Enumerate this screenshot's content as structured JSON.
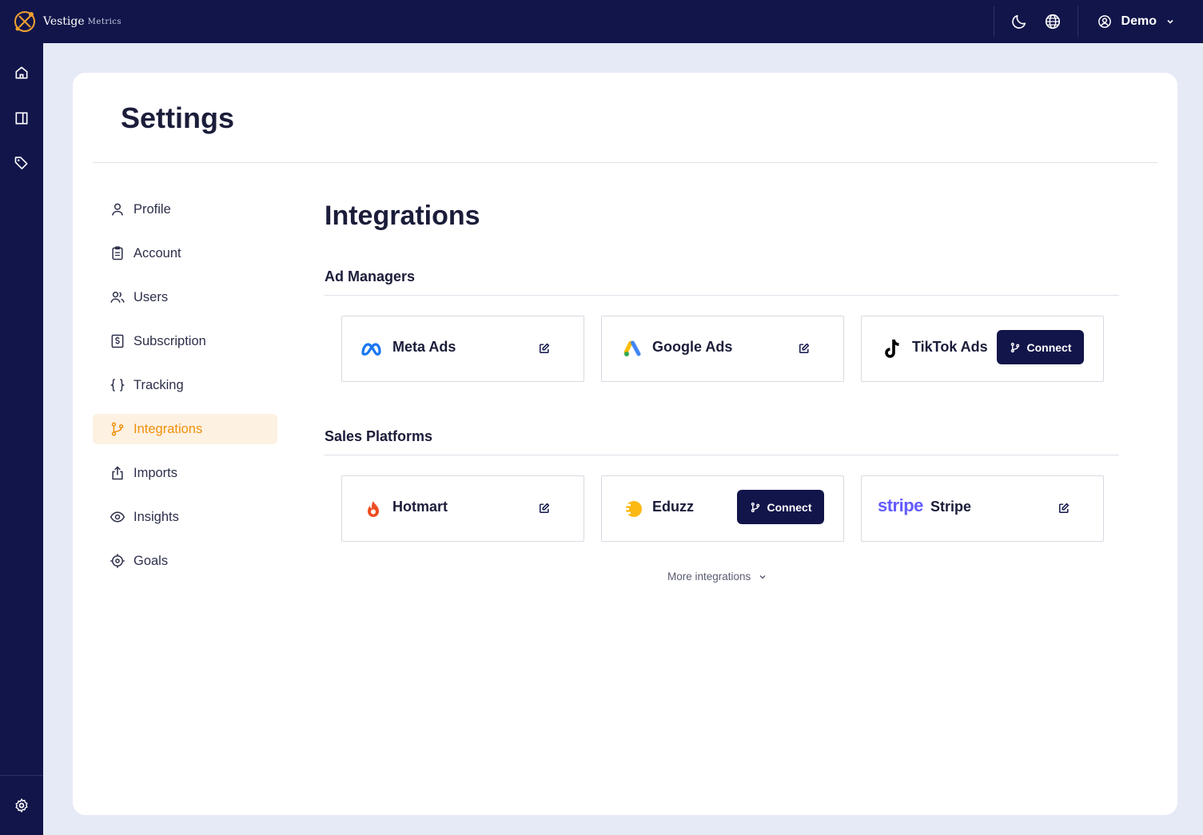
{
  "brand": {
    "name": "Vestige",
    "sub": "Metrics"
  },
  "user": {
    "name": "Demo"
  },
  "page": {
    "title": "Settings"
  },
  "settings_nav": [
    {
      "label": "Profile",
      "icon": "user-icon"
    },
    {
      "label": "Account",
      "icon": "clipboard-icon"
    },
    {
      "label": "Users",
      "icon": "users-icon"
    },
    {
      "label": "Subscription",
      "icon": "dollar-square-icon"
    },
    {
      "label": "Tracking",
      "icon": "braces-icon"
    },
    {
      "label": "Integrations",
      "icon": "git-branch-icon",
      "active": true
    },
    {
      "label": "Imports",
      "icon": "upload-icon"
    },
    {
      "label": "Insights",
      "icon": "eye-icon"
    },
    {
      "label": "Goals",
      "icon": "target-icon"
    }
  ],
  "integrations": {
    "title": "Integrations",
    "ad_managers": {
      "title": "Ad Managers",
      "items": [
        {
          "name": "Meta Ads",
          "logo": "meta-logo",
          "action": "edit"
        },
        {
          "name": "Google Ads",
          "logo": "google-ads-logo",
          "action": "edit"
        },
        {
          "name": "TikTok Ads",
          "logo": "tiktok-logo",
          "action": "connect",
          "connect_label": "Connect"
        }
      ]
    },
    "sales_platforms": {
      "title": "Sales Platforms",
      "items": [
        {
          "name": "Hotmart",
          "logo": "hotmart-logo",
          "action": "edit"
        },
        {
          "name": "Eduzz",
          "logo": "eduzz-logo",
          "action": "connect",
          "connect_label": "Connect"
        },
        {
          "name": "Stripe",
          "logo": "stripe-logo",
          "logo_text": "stripe",
          "action": "edit"
        }
      ]
    },
    "more_label": "More integrations"
  },
  "colors": {
    "navy": "#12154a",
    "accent": "#f0900a",
    "active_bg": "#fdf1e2",
    "background": "#e6eaf6"
  }
}
